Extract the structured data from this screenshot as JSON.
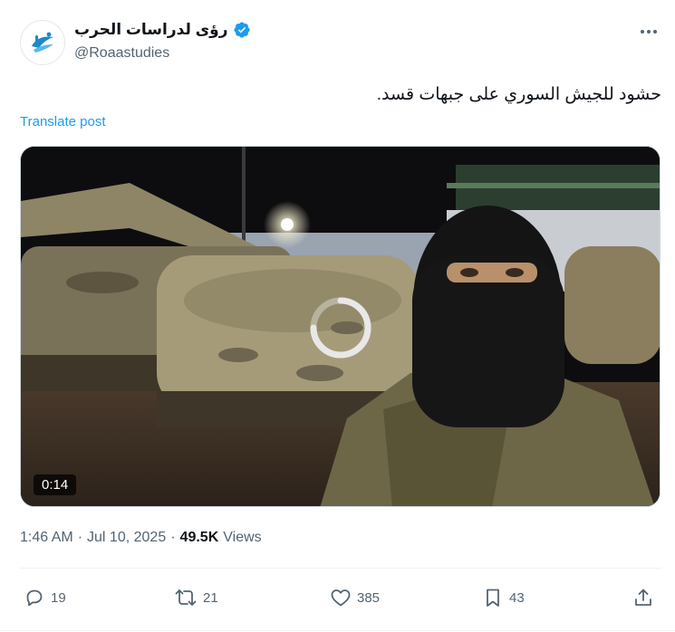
{
  "author": {
    "display_name": "رؤى لدراسات الحرب",
    "handle": "@Roaastudies",
    "verified": true,
    "avatar_icon": "roaa-logo"
  },
  "post": {
    "text": "حشود للجيش السوري على جبهات قسد.",
    "translate_label": "Translate post"
  },
  "video": {
    "duration": "0:14",
    "state": "loading"
  },
  "meta": {
    "time": "1:46 AM",
    "date": "Jul 10, 2025",
    "views_count": "49.5K",
    "views_label": "Views"
  },
  "actions": {
    "replies": "19",
    "reposts": "21",
    "likes": "385",
    "bookmarks": "43"
  },
  "colors": {
    "accent": "#1d9bf0",
    "secondary_text": "#536471",
    "primary_text": "#0f1419"
  }
}
